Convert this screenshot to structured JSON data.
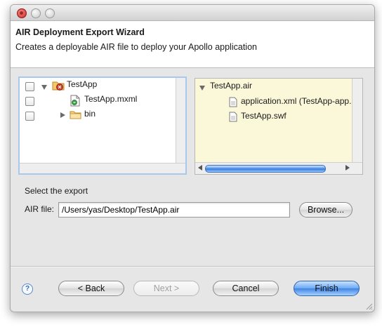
{
  "window": {
    "header_title": "AIR Deployment Export Wizard",
    "header_subtitle": "Creates a deployable AIR file to deploy your Apollo application"
  },
  "left_tree": {
    "items": [
      {
        "label": "TestApp",
        "icon": "project-folder-icon",
        "expanded": true,
        "checked": false
      },
      {
        "label": "TestApp.mxml",
        "icon": "mxml-file-icon",
        "checked": false
      },
      {
        "label": "bin",
        "icon": "folder-icon",
        "expanded": false,
        "checked": false
      }
    ]
  },
  "right_tree": {
    "root": "TestApp.air",
    "items": [
      {
        "label": "application.xml (TestApp-app.",
        "icon": "document-icon"
      },
      {
        "label": "TestApp.swf",
        "icon": "document-icon"
      }
    ]
  },
  "export": {
    "section_label": "Select the export",
    "air_file_label": "AIR file:",
    "air_file_value": "/Users/yas/Desktop/TestApp.air",
    "browse_label": "Browse..."
  },
  "buttons": {
    "help": "?",
    "back": "< Back",
    "next": "Next >",
    "cancel": "Cancel",
    "finish": "Finish"
  },
  "colors": {
    "accent": "#3f85e4",
    "right_panel_bg": "#fbf8da",
    "focus_border": "#aac8ec"
  }
}
